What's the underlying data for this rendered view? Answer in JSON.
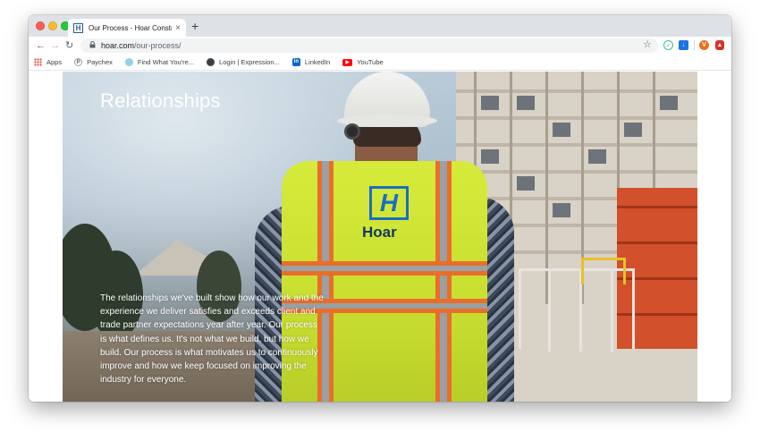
{
  "browser": {
    "tab_title": "Our Process - Hoar Constructi",
    "tab_favicon_glyph": "H",
    "new_tab_glyph": "+",
    "close_glyph": "×",
    "url_host": "hoar.com",
    "url_path": "/our-process/",
    "extension_avatar_letter": "V"
  },
  "bookmarks": [
    {
      "label": "Apps"
    },
    {
      "label": "Paychex"
    },
    {
      "label": "Find What You're..."
    },
    {
      "label": "Login | Expression..."
    },
    {
      "label": "LinkedIn"
    },
    {
      "label": "YouTube"
    }
  ],
  "hero": {
    "title": "Relationships",
    "body": "The relationships we've built show how our work and the experience we deliver satisfies and exceeds client and trade partner expectations year after year. Our process is what defines us. It's not what we build, but how we build. Our process is what motivates us to continuously improve and how we keep focused on improving the industry for everyone.",
    "vest_wordmark": "Hoar",
    "vest_logo_glyph": "H"
  },
  "icons": {
    "back": "←",
    "forward": "→",
    "reload": "↻",
    "lock": "🔒",
    "star": "☆"
  },
  "colors": {
    "vest": "#d6ea3a",
    "vest_stripe": "#e96e2a",
    "brand_blue": "#1a6ec2"
  }
}
